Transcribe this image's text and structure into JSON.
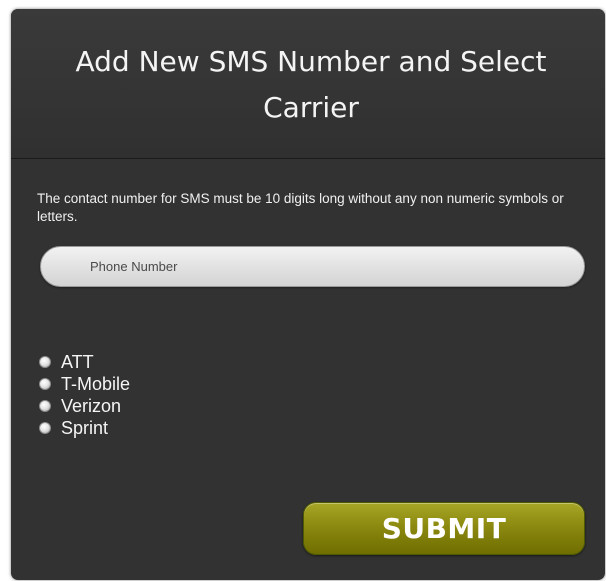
{
  "dialog": {
    "title": "Add New SMS Number and Select Carrier",
    "instructions": "The contact number for SMS must be 10 digits long without any non numeric symbols or letters.",
    "phone": {
      "value": "",
      "placeholder": "Phone Number"
    },
    "carriers": [
      {
        "label": "ATT",
        "selected": false
      },
      {
        "label": "T-Mobile",
        "selected": false
      },
      {
        "label": "Verizon",
        "selected": false
      },
      {
        "label": "Sprint",
        "selected": false
      }
    ],
    "submit_label": "SUBMIT"
  },
  "colors": {
    "panel_background": "#323232",
    "title_text": "#f4f4f4",
    "submit_button": "#8c8a10",
    "input_background": "#e4e4e4"
  }
}
